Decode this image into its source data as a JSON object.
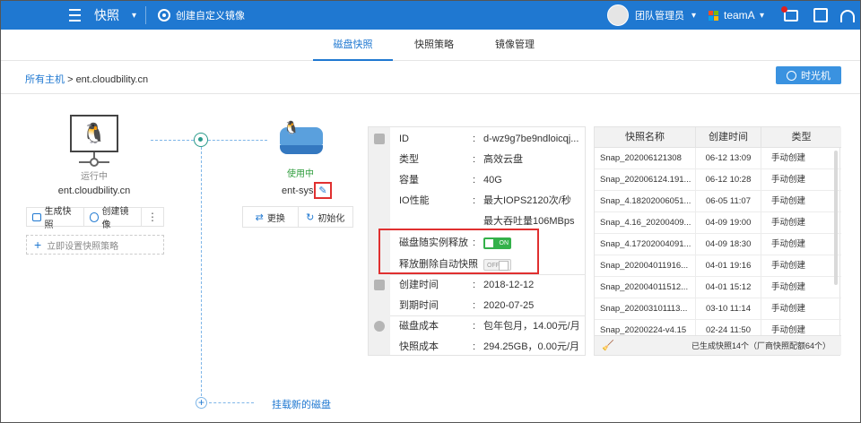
{
  "topbar": {
    "app_title": "快照",
    "custom_image": "创建自定义镜像",
    "user_name": "团队管理员",
    "team_name": "teamA"
  },
  "tabs": [
    {
      "label": "磁盘快照",
      "active": true
    },
    {
      "label": "快照策略",
      "active": false
    },
    {
      "label": "镜像管理",
      "active": false
    }
  ],
  "breadcrumb": {
    "root": "所有主机",
    "separator": ">",
    "current": "ent.cloudbility.cn"
  },
  "time_machine_label": "时光机",
  "host": {
    "status": "运行中",
    "name": "ent.cloudbility.cn",
    "actions": [
      "生成快照",
      "创建镜像"
    ],
    "policy_label": "立即设置快照策略"
  },
  "disk": {
    "status": "使用中",
    "name": "ent-sys",
    "actions": [
      "更换",
      "初始化"
    ]
  },
  "mount_label": "挂载新的磁盘",
  "info": {
    "id": {
      "label": "ID",
      "value": "d-wz9g7be9ndloicqj..."
    },
    "type": {
      "label": "类型",
      "value": "高效云盘"
    },
    "capacity": {
      "label": "容量",
      "value": "40G"
    },
    "io": {
      "label": "IO性能",
      "value": "最大IOPS2120次/秒"
    },
    "throughput": {
      "value": "最大吞吐量106MBps"
    },
    "release_with_instance": {
      "label": "磁盘随实例释放",
      "toggle": "ON"
    },
    "release_delete_snap": {
      "label": "释放删除自动快照",
      "toggle": "OFF"
    },
    "created": {
      "label": "创建时间",
      "value": "2018-12-12"
    },
    "expire": {
      "label": "到期时间",
      "value": "2020-07-25"
    },
    "disk_cost": {
      "label": "磁盘成本",
      "value": "包年包月，14.00元/月"
    },
    "snap_cost": {
      "label": "快照成本",
      "value": "294.25GB，0.00元/月"
    }
  },
  "snapshots": {
    "headers": [
      "快照名称",
      "创建时间",
      "类型"
    ],
    "rows": [
      [
        "Snap_202006121308",
        "06-12 13:09",
        "手动创建"
      ],
      [
        "Snap_20200612​4.191...",
        "06-12 10:28",
        "手动创建"
      ],
      [
        "Snap_4.18202006051...",
        "06-05 11:07",
        "手动创建"
      ],
      [
        "Snap_4.16_20200409...",
        "04-09 19:00",
        "手动创建"
      ],
      [
        "Snap_4.17202004091...",
        "04-09 18:30",
        "手动创建"
      ],
      [
        "Snap_20200401​1916...",
        "04-01 19:16",
        "手动创建"
      ],
      [
        "Snap_20200401​1512...",
        "04-01 15:12",
        "手动创建"
      ],
      [
        "Snap_20200310​1113...",
        "03-10 11:14",
        "手动创建"
      ],
      [
        "Snap_20200224-v4.15",
        "02-24 11:50",
        "手动创建"
      ]
    ],
    "footer": "已生成快照14个（厂商快照配额64个）"
  }
}
